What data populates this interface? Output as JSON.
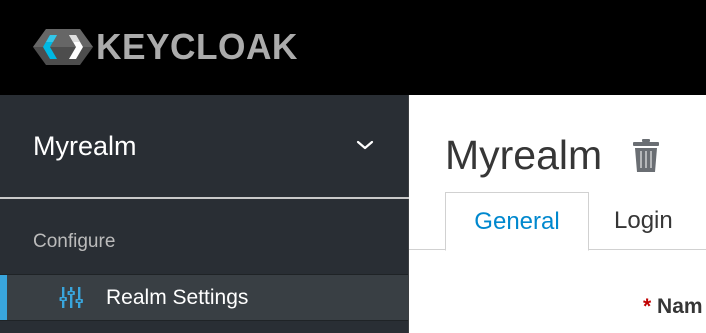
{
  "header": {
    "brand_name": "KEYCLOAK",
    "logo_icon": "keycloak-logo"
  },
  "sidebar": {
    "realm_selector": {
      "label": "Myrealm",
      "icon": "chevron-down-icon"
    },
    "section_label": "Configure",
    "items": [
      {
        "label": "Realm Settings",
        "icon": "sliders-icon",
        "active": true
      }
    ]
  },
  "main": {
    "title": "Myrealm",
    "delete_icon": "trash-icon",
    "tabs": [
      {
        "label": "General",
        "active": true
      },
      {
        "label": "Login",
        "active": false
      }
    ],
    "form": {
      "required_marker": "*",
      "name_label": "Nam"
    }
  },
  "colors": {
    "header_bg": "#000000",
    "sidebar_bg": "#292e34",
    "active_item_bg": "#393f44",
    "active_accent": "#39a5dc",
    "link_blue": "#0088ce",
    "required_red": "#c00000"
  }
}
